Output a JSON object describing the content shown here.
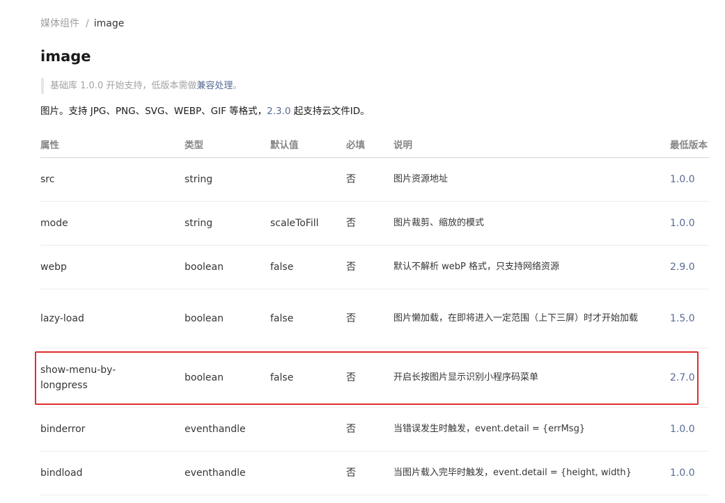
{
  "breadcrumb": {
    "parent": "媒体组件",
    "separator": "/",
    "current": "image"
  },
  "title": "image",
  "note": {
    "prefix": "基础库 1.0.0 开始支持，低版本需做",
    "link": "兼容处理",
    "suffix": "。"
  },
  "intro": {
    "before": "图片。支持 JPG、PNG、SVG、WEBP、GIF 等格式，",
    "version": "2.3.0",
    "after": " 起支持云文件ID。"
  },
  "table": {
    "headers": [
      "属性",
      "类型",
      "默认值",
      "必填",
      "说明",
      "最低版本"
    ],
    "rows": [
      {
        "name": "src",
        "type": "string",
        "default": "",
        "required": "否",
        "desc": "图片资源地址",
        "version": "1.0.0"
      },
      {
        "name": "mode",
        "type": "string",
        "default": "scaleToFill",
        "required": "否",
        "desc": "图片裁剪、缩放的模式",
        "version": "1.0.0"
      },
      {
        "name": "webp",
        "type": "boolean",
        "default": "false",
        "required": "否",
        "desc": "默认不解析 webP 格式，只支持网络资源",
        "version": "2.9.0"
      },
      {
        "name": "lazy-load",
        "type": "boolean",
        "default": "false",
        "required": "否",
        "desc": "图片懒加载，在即将进入一定范围（上下三屏）时才开始加载",
        "version": "1.5.0"
      },
      {
        "name": "show-menu-by-longpress",
        "type": "boolean",
        "default": "false",
        "required": "否",
        "desc": "开启长按图片显示识别小程序码菜单",
        "version": "2.7.0"
      },
      {
        "name": "binderror",
        "type": "eventhandle",
        "default": "",
        "required": "否",
        "desc": "当错误发生时触发，event.detail = {errMsg}",
        "version": "1.0.0"
      },
      {
        "name": "bindload",
        "type": "eventhandle",
        "default": "",
        "required": "否",
        "desc": "当图片载入完毕时触发，event.detail = {height, width}",
        "version": "1.0.0"
      }
    ]
  },
  "highlight_color": "#e02d2d",
  "link_color": "#576b95"
}
